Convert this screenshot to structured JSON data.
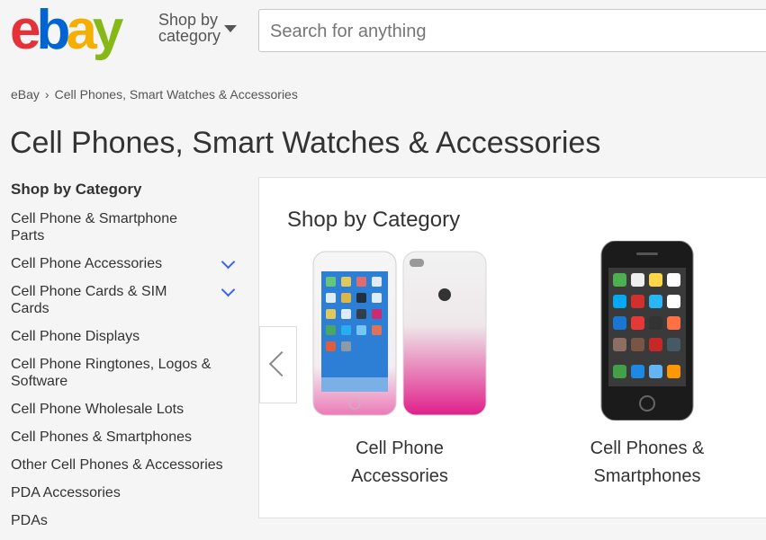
{
  "header": {
    "logo_letters": [
      {
        "char": "e",
        "color": "#e53238"
      },
      {
        "char": "b",
        "color": "#0064d2"
      },
      {
        "char": "a",
        "color": "#f5af02"
      },
      {
        "char": "y",
        "color": "#86b817"
      }
    ],
    "shop_by_line1": "Shop by",
    "shop_by_line2": "category",
    "search_placeholder": "Search for anything"
  },
  "breadcrumb": {
    "items": [
      "eBay",
      "Cell Phones, Smart Watches & Accessories"
    ]
  },
  "page_title": "Cell Phones, Smart Watches & Accessories",
  "sidebar": {
    "heading": "Shop by Category",
    "items": [
      {
        "label": "Cell Phone & Smartphone Parts",
        "expandable": false
      },
      {
        "label": "Cell Phone Accessories",
        "expandable": true
      },
      {
        "label": "Cell Phone Cards & SIM Cards",
        "expandable": true
      },
      {
        "label": "Cell Phone Displays",
        "expandable": false
      },
      {
        "label": "Cell Phone Ringtones, Logos & Software",
        "expandable": false
      },
      {
        "label": "Cell Phone Wholesale Lots",
        "expandable": false
      },
      {
        "label": "Cell Phones & Smartphones",
        "expandable": false
      },
      {
        "label": "Other Cell Phones & Accessories",
        "expandable": false
      },
      {
        "label": "PDA Accessories",
        "expandable": false
      },
      {
        "label": "PDAs",
        "expandable": false
      }
    ]
  },
  "panel": {
    "title": "Shop by Category",
    "cards": [
      {
        "line1": "Cell Phone",
        "line2": "Accessories"
      },
      {
        "line1": "Cell Phones &",
        "line2": "Smartphones"
      }
    ]
  },
  "colors": {
    "accent_blue": "#3665f3",
    "case_pink": "#e0208a"
  }
}
